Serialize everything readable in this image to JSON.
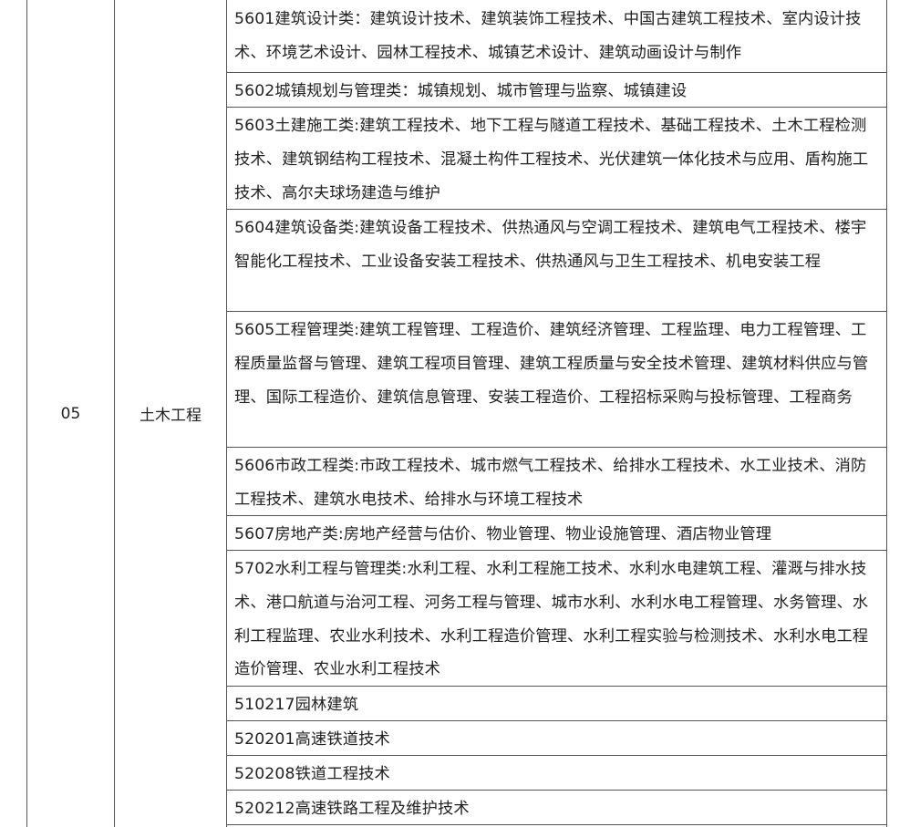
{
  "table": {
    "category_code": "05",
    "category_name": "土木工程",
    "rows": [
      "5601建筑设计类：建筑设计技术、建筑装饰工程技术、中国古建筑工程技术、室内设计技术、环境艺术设计、园林工程技术、城镇艺术设计、建筑动画设计与制作",
      "5602城镇规划与管理类：城镇规划、城市管理与监察、城镇建设",
      "5603土建施工类:建筑工程技术、地下工程与隧道工程技术、基础工程技术、土木工程检测技术、建筑钢结构工程技术、混凝土构件工程技术、光伏建筑一体化技术与应用、盾构施工技术、高尔夫球场建造与维护",
      "5604建筑设备类:建筑设备工程技术、供热通风与空调工程技术、建筑电气工程技术、楼宇智能化工程技术、工业设备安装工程技术、供热通风与卫生工程技术、机电安装工程",
      "5605工程管理类:建筑工程管理、工程造价、建筑经济管理、工程监理、电力工程管理、工程质量监督与管理、建筑工程项目管理、建筑工程质量与安全技术管理、建筑材料供应与管理、国际工程造价、建筑信息管理、安装工程造价、工程招标采购与投标管理、工程商务",
      "5606市政工程类:市政工程技术、城市燃气工程技术、给排水工程技术、水工业技术、消防工程技术、建筑水电技术、给排水与环境工程技术",
      "5607房地产类:房地产经营与估价、物业管理、物业设施管理、酒店物业管理",
      "5702水利工程与管理类:水利工程、水利工程施工技术、水利水电建筑工程、灌溉与排水技术、港口航道与治河工程、河务工程与管理、城市水利、水利水电工程管理、水务管理、水利工程监理、农业水利技术、水利工程造价管理、水利工程实验与检测技术、水利水电工程造价管理、农业水利工程技术",
      "510217园林建筑",
      "520201高速铁道技术",
      "520208铁道工程技术",
      "520212高速铁路工程及维护技术"
    ]
  }
}
